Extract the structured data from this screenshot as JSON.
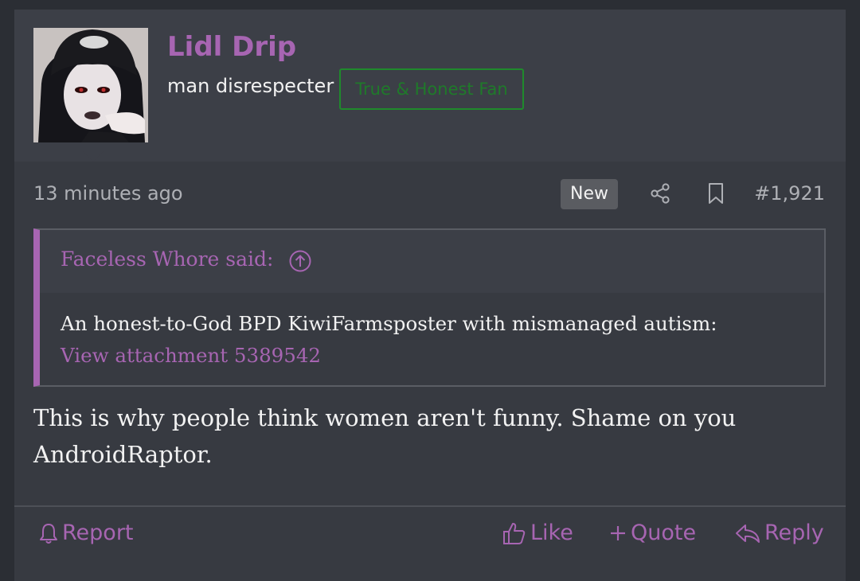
{
  "post": {
    "author": {
      "username": "Lidl Drip",
      "user_title": "man disrespecter",
      "banner": "True & Honest Fan"
    },
    "meta": {
      "time": "13 minutes ago",
      "new_badge": "New",
      "post_number": "#1,921"
    },
    "quote": {
      "attribution": "Faceless Whore said:",
      "text": "An honest-to-God BPD KiwiFarmsposter with mismanaged autism:",
      "attachment_link": "View attachment 5389542"
    },
    "message": "This is why people think women aren't funny. Shame on you AndroidRaptor.",
    "actions": {
      "report": "Report",
      "like": "Like",
      "quote": "Quote",
      "reply": "Reply"
    }
  },
  "colors": {
    "accent": "#a765b2",
    "banner_green": "#1f8a2c",
    "background": "#373a41"
  },
  "icons": [
    "share-icon",
    "bookmark-icon",
    "arrow-up-circle-icon",
    "bell-icon",
    "thumbs-up-icon",
    "plus-icon",
    "reply-icon"
  ]
}
